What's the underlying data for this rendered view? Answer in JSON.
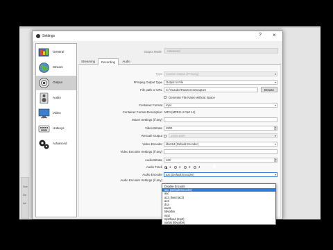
{
  "window": {
    "title": "Settings",
    "help_label": "?",
    "close_label": "×"
  },
  "background": {
    "side_labels": [
      "Sce",
      "De",
      "Ab"
    ]
  },
  "sidebar": {
    "items": [
      {
        "label": "General"
      },
      {
        "label": "Stream"
      },
      {
        "label": "Output"
      },
      {
        "label": "Audio"
      },
      {
        "label": "Video"
      },
      {
        "label": "Hotkeys"
      },
      {
        "label": "Advanced"
      }
    ]
  },
  "output": {
    "mode_label": "Output Mode",
    "mode_value": "Advanced",
    "tabs": [
      {
        "label": "Streaming"
      },
      {
        "label": "Recording"
      },
      {
        "label": "Audio"
      }
    ],
    "type_label": "Type",
    "type_value": "Custom Output (FFmpeg)",
    "ffmpeg_output_type_label": "FFmpeg Output Type",
    "ffmpeg_output_type_value": "Output to File",
    "file_path_label": "File path or URL",
    "file_path_value": "C:/Youtube/RawScreenCapture",
    "browse_label": "Browse",
    "generate_name_label": "Generate File Name without Space",
    "container_format_label": "Container Format",
    "container_format_value": "mp4",
    "container_desc_label": "Container Format Description",
    "container_desc_value": "MP4 (MPEG-4 Part 14)",
    "muxer_label": "Muxer Settings (if any)",
    "muxer_value": "",
    "video_bitrate_label": "Video Bitrate",
    "video_bitrate_value": "4500",
    "rescale_label": "Rescale Output",
    "rescale_value": "1920x1080",
    "video_encoder_label": "Video Encoder",
    "video_encoder_value": "libx264 (Default Encoder)",
    "video_encoder_settings_label": "Video Encoder Settings (if any)",
    "video_encoder_settings_value": "",
    "audio_bitrate_label": "Audio Bitrate",
    "audio_bitrate_value": "160",
    "audio_track_label": "Audio Track",
    "audio_tracks": [
      "1",
      "2",
      "3",
      "4"
    ],
    "audio_encoder_label": "Audio Encoder",
    "audio_encoder_value": "aac (Default Encoder)",
    "audio_encoder_settings_label": "Audio Encoder Settings (if any)",
    "audio_encoder_options": [
      "Disable Encoder",
      "aac (Default Encoder)",
      "aac",
      "ac3_fixed (ac3)",
      "ac3",
      "dca",
      "eac3",
      "libvorbis",
      "mp2",
      "mp2fixed (mp2)",
      "vorbis (libvorbis)"
    ],
    "audio_encoder_selected_index": 1
  },
  "colors": {
    "selection": "#2f7bd6",
    "sidebar_active": "#cfcfcf"
  }
}
